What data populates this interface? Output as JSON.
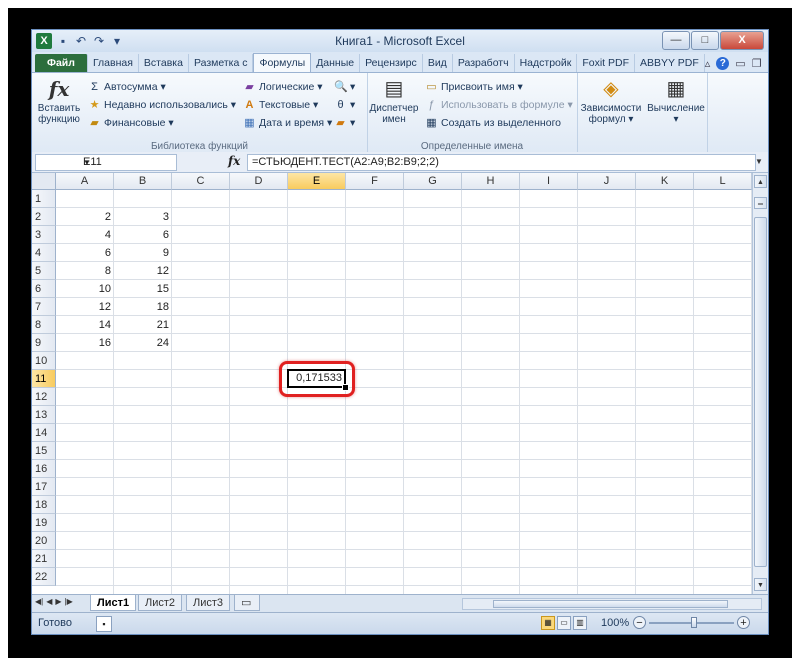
{
  "window": {
    "title": "Книга1 - Microsoft Excel",
    "app_logo": "X",
    "controls": {
      "minimize": "—",
      "maximize": "□",
      "close": "X"
    }
  },
  "quick_access": {
    "save_icon": "save-icon",
    "undo_icon": "undo-icon",
    "redo_icon": "redo-icon"
  },
  "ribbon_tabs": [
    {
      "label": "Файл"
    },
    {
      "label": "Главная"
    },
    {
      "label": "Вставка"
    },
    {
      "label": "Разметка с"
    },
    {
      "label": "Формулы"
    },
    {
      "label": "Данные"
    },
    {
      "label": "Рецензирс"
    },
    {
      "label": "Вид"
    },
    {
      "label": "Разработч"
    },
    {
      "label": "Надстройк"
    },
    {
      "label": "Foxit PDF"
    },
    {
      "label": "ABBYY PDF"
    }
  ],
  "ribbon": {
    "insert_function": {
      "line1": "Вставить",
      "line2": "функцию"
    },
    "autosum": "Автосумма",
    "recent": "Недавно использовались",
    "financial": "Финансовые",
    "logical": "Логические",
    "text": "Текстовые",
    "datetime": "Дата и время",
    "library_label": "Библиотека функций",
    "name_manager": {
      "line1": "Диспетчер",
      "line2": "имен"
    },
    "define_name": "Присвоить имя",
    "use_in_formula": "Использовать в формуле",
    "create_from_selection": "Создать из выделенного",
    "names_label": "Определенные имена",
    "dependencies": {
      "line1": "Зависимости",
      "line2": "формул"
    },
    "calculation": "Вычисление"
  },
  "formula_bar": {
    "name_box": "E11",
    "fx": "fx",
    "formula": "=СТЬЮДЕНТ.ТЕСТ(A2:A9;B2:B9;2;2)"
  },
  "columns": [
    "A",
    "B",
    "C",
    "D",
    "E",
    "F",
    "G",
    "H",
    "I",
    "J",
    "K",
    "L"
  ],
  "rows": [
    "1",
    "2",
    "3",
    "4",
    "5",
    "6",
    "7",
    "8",
    "9",
    "10",
    "11",
    "12",
    "13",
    "14",
    "15",
    "16",
    "17",
    "18",
    "19",
    "20",
    "21",
    "22"
  ],
  "data": {
    "col_a": [
      "2",
      "4",
      "6",
      "8",
      "10",
      "12",
      "14",
      "16"
    ],
    "col_b": [
      "3",
      "6",
      "9",
      "12",
      "15",
      "18",
      "21",
      "24"
    ]
  },
  "active_cell": {
    "ref": "E11",
    "value": "0,171533"
  },
  "sheets": [
    {
      "label": "Лист1"
    },
    {
      "label": "Лист2"
    },
    {
      "label": "Лист3"
    }
  ],
  "status": {
    "ready": "Готово",
    "zoom": "100%"
  },
  "colors": {
    "highlight": "#e02020",
    "file_tab": "#2c6e3d"
  }
}
